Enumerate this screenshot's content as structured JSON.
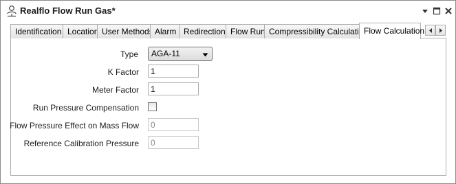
{
  "window": {
    "title": "Realflo Flow Run Gas*"
  },
  "tabs": [
    {
      "label": "Identification"
    },
    {
      "label": "Location"
    },
    {
      "label": "User Methods"
    },
    {
      "label": "Alarm"
    },
    {
      "label": "Redirection"
    },
    {
      "label": "Flow Run"
    },
    {
      "label": "Compressibility Calculation"
    },
    {
      "label": "Flow Calculation",
      "active": true
    }
  ],
  "form": {
    "type_label": "Type",
    "type_value": "AGA-11",
    "k_factor_label": "K Factor",
    "k_factor_value": "1",
    "meter_factor_label": "Meter Factor",
    "meter_factor_value": "1",
    "run_pressure_comp_label": "Run Pressure Compensation",
    "run_pressure_comp_checked": false,
    "flow_pressure_effect_label": "Flow Pressure Effect on Mass Flow",
    "flow_pressure_effect_value": "0",
    "ref_calibration_pressure_label": "Reference Calibration Pressure",
    "ref_calibration_pressure_value": "0"
  },
  "icons": {
    "title": "user-network-icon",
    "dropdown": "chevron-down-icon",
    "maximize": "maximize-icon",
    "close": "close-icon",
    "scroll_left": "chevron-left-icon",
    "scroll_right": "chevron-right-icon"
  }
}
